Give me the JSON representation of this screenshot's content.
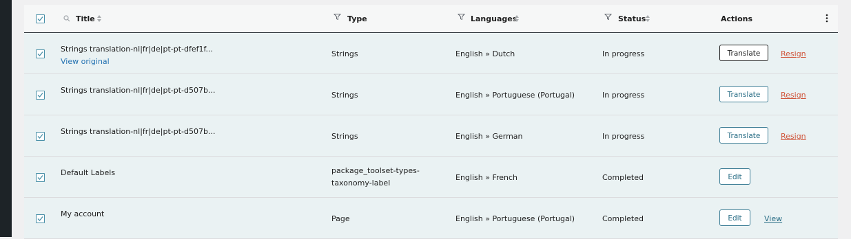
{
  "header": {
    "title": "Title",
    "type": "Type",
    "languages": "Languages",
    "status": "Status",
    "actions": "Actions"
  },
  "rows": [
    {
      "title": "Strings translation-nl|fr|de|pt-pt-dfef1f...",
      "subtitle": "View original",
      "type": "Strings",
      "languages": "English » Dutch",
      "status": "In progress",
      "primary_action": "Translate",
      "secondary_action": "Resign"
    },
    {
      "title": "Strings translation-nl|fr|de|pt-pt-d507b...",
      "type": "Strings",
      "languages": "English » Portuguese (Portugal)",
      "status": "In progress",
      "primary_action": "Translate",
      "secondary_action": "Resign"
    },
    {
      "title": "Strings translation-nl|fr|de|pt-pt-d507b...",
      "type": "Strings",
      "languages": "English » German",
      "status": "In progress",
      "primary_action": "Translate",
      "secondary_action": "Resign"
    },
    {
      "title": "Default Labels",
      "type": "package_toolset-types-taxonomy-label",
      "type_line1": "package_toolset-types-",
      "type_line2": "taxonomy-label",
      "languages": "English » French",
      "status": "Completed",
      "primary_action": "Edit"
    },
    {
      "title": "My account",
      "type": "Page",
      "languages": "English » Portuguese (Portugal)",
      "status": "Completed",
      "primary_action": "Edit",
      "secondary_action": "View"
    }
  ],
  "colors": {
    "row_background": "#eaf2f3",
    "accent": "#2a6e86",
    "resign": "#d0553a"
  },
  "icons": {
    "select_all": "checkbox-checked-icon",
    "search": "search-icon",
    "sort": "sort-icon",
    "filter": "filter-icon",
    "more": "kebab-icon"
  }
}
